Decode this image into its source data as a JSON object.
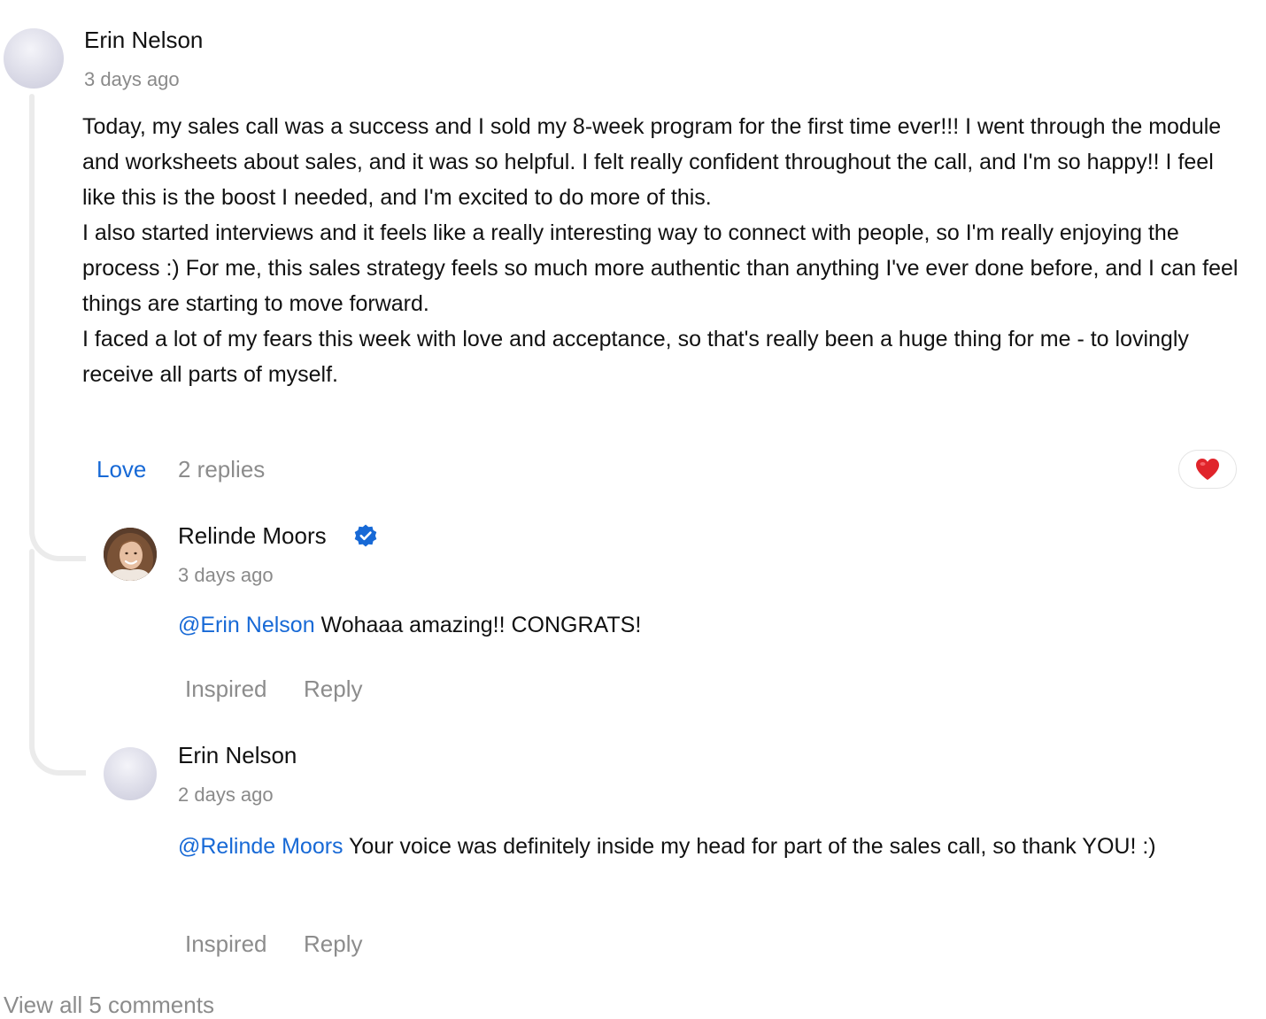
{
  "post": {
    "author": "Erin Nelson",
    "time": "3 days ago",
    "paragraphs": [
      "Today, my sales call was a success and I sold my 8-week program for the first time ever!!! I went through the module and worksheets about sales, and it was so helpful. I felt really confident throughout the call, and I'm so happy!! I feel like this is the boost I needed, and I'm excited to do more of this.",
      "I also started interviews and it feels like a really interesting way to connect with people, so I'm really enjoying the process :) For me, this sales strategy feels so much more authentic than anything I've ever done before, and I can feel things are starting to move forward.",
      "I faced a lot of my fears this week with love and acceptance, so that's really been a huge thing for me - to lovingly receive all parts of myself."
    ],
    "reaction_label": "Love",
    "replies_label": "2 replies",
    "reaction_emoji": "❤️",
    "reaction_icon": "heart-icon",
    "reaction_color": "#e0242b"
  },
  "replies": [
    {
      "author": "Relinde Moors",
      "verified": true,
      "verified_icon": "verified-badge-icon",
      "verified_color": "#1769d6",
      "time": "3 days ago",
      "mention": "@Erin Nelson",
      "text": " Wohaaa amazing!! CONGRATS!",
      "action_1": "Inspired",
      "action_2": "Reply"
    },
    {
      "author": "Erin Nelson",
      "time": "2 days ago",
      "mention": "@Relinde Moors",
      "text": " Your voice was definitely inside my head for part of the sales call, so thank YOU! :)",
      "action_1": "Inspired",
      "action_2": "Reply"
    }
  ],
  "footer": {
    "view_all": "View all 5 comments"
  },
  "colors": {
    "accent": "#1769d6",
    "muted": "#8c8c8c",
    "thread_line": "#ebebeb"
  }
}
